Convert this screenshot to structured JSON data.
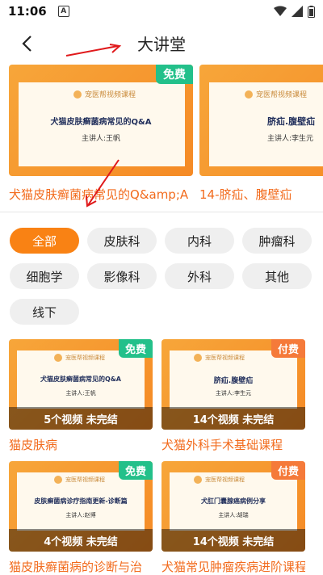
{
  "status": {
    "time": "11:06",
    "a_icon": "A"
  },
  "header": {
    "title": "大讲堂"
  },
  "banner": [
    {
      "tag": "免费",
      "tag_type": "free",
      "logo": "宠医帮视频课程",
      "heading": "犬猫皮肤癣菌病常见的Q&A",
      "speaker": "主讲人:王帆",
      "caption": "犬猫皮肤癣菌病常见的Q&amp;A"
    },
    {
      "tag": "",
      "tag_type": "none",
      "logo": "宠医帮视频课程",
      "heading": "脐疝.腹壁疝",
      "speaker": "主讲人:李生元",
      "caption": "14-脐疝、腹壁疝"
    }
  ],
  "filters": [
    {
      "label": "全部",
      "active": true
    },
    {
      "label": "皮肤科",
      "active": false
    },
    {
      "label": "内科",
      "active": false
    },
    {
      "label": "肿瘤科",
      "active": false
    },
    {
      "label": "细胞学",
      "active": false
    },
    {
      "label": "影像科",
      "active": false
    },
    {
      "label": "外科",
      "active": false
    },
    {
      "label": "其他",
      "active": false
    },
    {
      "label": "线下",
      "active": false
    }
  ],
  "courses": [
    {
      "tag": "免费",
      "tag_type": "free",
      "logo": "宠医帮视频课程",
      "heading": "犬猫皮肤癣菌病常见的Q&A",
      "speaker": "主讲人:王帆",
      "status": "5个视频 未完结",
      "title": "猫皮肤病"
    },
    {
      "tag": "付费",
      "tag_type": "paid",
      "logo": "宠医帮视频课程",
      "heading": "脐疝.腹壁疝",
      "speaker": "主讲人:李生元",
      "status": "14个视频 未完结",
      "title": "犬猫外科手术基础课程"
    },
    {
      "tag": "免费",
      "tag_type": "free",
      "logo": "宠医帮视频课程",
      "heading": "皮肤癣菌病诊疗指南更新-诊断篇",
      "speaker": "主讲人:赵博",
      "status": "4个视频 未完结",
      "title": "猫皮肤癣菌病的诊断与治"
    },
    {
      "tag": "付费",
      "tag_type": "paid",
      "logo": "宠医帮视频课程",
      "heading": "犬肛门囊腺癌病例分享",
      "speaker": "主讲人:胡瑞",
      "status": "14个视频 未完结",
      "title": "犬猫常见肿瘤疾病进阶课程"
    }
  ],
  "colors": {
    "accent": "#f98214",
    "title_orange": "#f26b1d",
    "free": "#23c08a",
    "paid": "#f57a3a",
    "annotation": "#e0191b"
  }
}
